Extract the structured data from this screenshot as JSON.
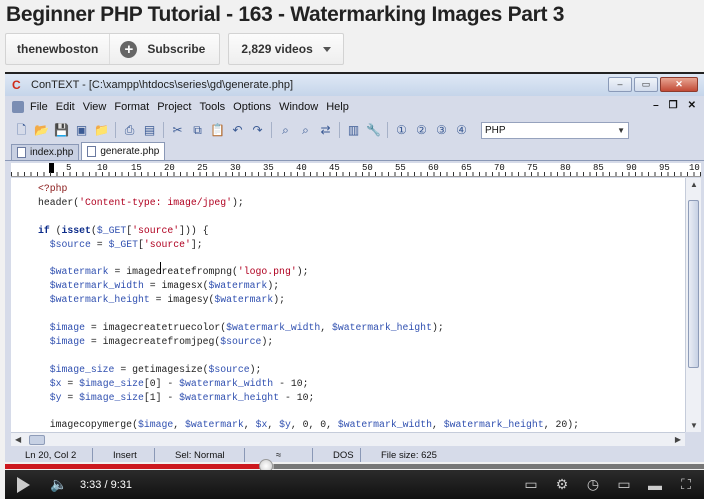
{
  "video_title": "Beginner PHP Tutorial - 163 - Watermarking Images Part 3",
  "channel": {
    "name": "thenewboston",
    "subscribe_label": "Subscribe",
    "videos_label": "2,829 videos"
  },
  "app": {
    "window_title": "ConTEXT - [C:\\xampp\\htdocs\\series\\gd\\generate.php]",
    "menu": [
      "File",
      "Edit",
      "View",
      "Format",
      "Project",
      "Tools",
      "Options",
      "Window",
      "Help"
    ],
    "highlighter": "PHP",
    "tabs": [
      {
        "label": "index.php",
        "active": false
      },
      {
        "label": "generate.php",
        "active": true
      }
    ],
    "ruler_numbers": [
      "5",
      "10",
      "15",
      "20",
      "25",
      "30",
      "35",
      "40",
      "45",
      "50",
      "55",
      "60",
      "65",
      "70",
      "75",
      "80",
      "85",
      "90",
      "95",
      "10"
    ],
    "status": {
      "position": "Ln 20, Col 2",
      "mode": "Insert",
      "selection": "Sel: Normal",
      "line_endings": "DOS",
      "file_size": "File size: 625"
    }
  },
  "code_lines": [
    "<?php",
    "header('Content-type: image/jpeg');",
    "",
    "if (isset($_GET['source'])) {",
    "  $source = $_GET['source'];",
    "",
    "  $watermark = imagecreatefrompng('logo.png');",
    "  $watermark_width = imagesx($watermark);",
    "  $watermark_height = imagesy($watermark);",
    "",
    "  $image = imagecreatetruecolor($watermark_width, $watermark_height);",
    "  $image = imagecreatefromjpeg($source);",
    "",
    "  $image_size = getimagesize($source);",
    "  $x = $image_size[0] - $watermark_width - 10;",
    "  $y = $image_size[1] - $watermark_height - 10;",
    "",
    "  imagecopymerge($image, $watermark, $x, $y, 0, 0, $watermark_width, $watermark_height, 20);"
  ],
  "player": {
    "current_time": "3:33",
    "duration": "9:31",
    "time_display": "3:33 / 9:31",
    "played_fraction": 0.373,
    "loaded_fraction": 0.385
  },
  "colors": {
    "progress_played": "#cc181e",
    "editor_keyword": "#0c2c8a",
    "editor_variable": "#3050b0",
    "editor_string": "#b00020"
  }
}
